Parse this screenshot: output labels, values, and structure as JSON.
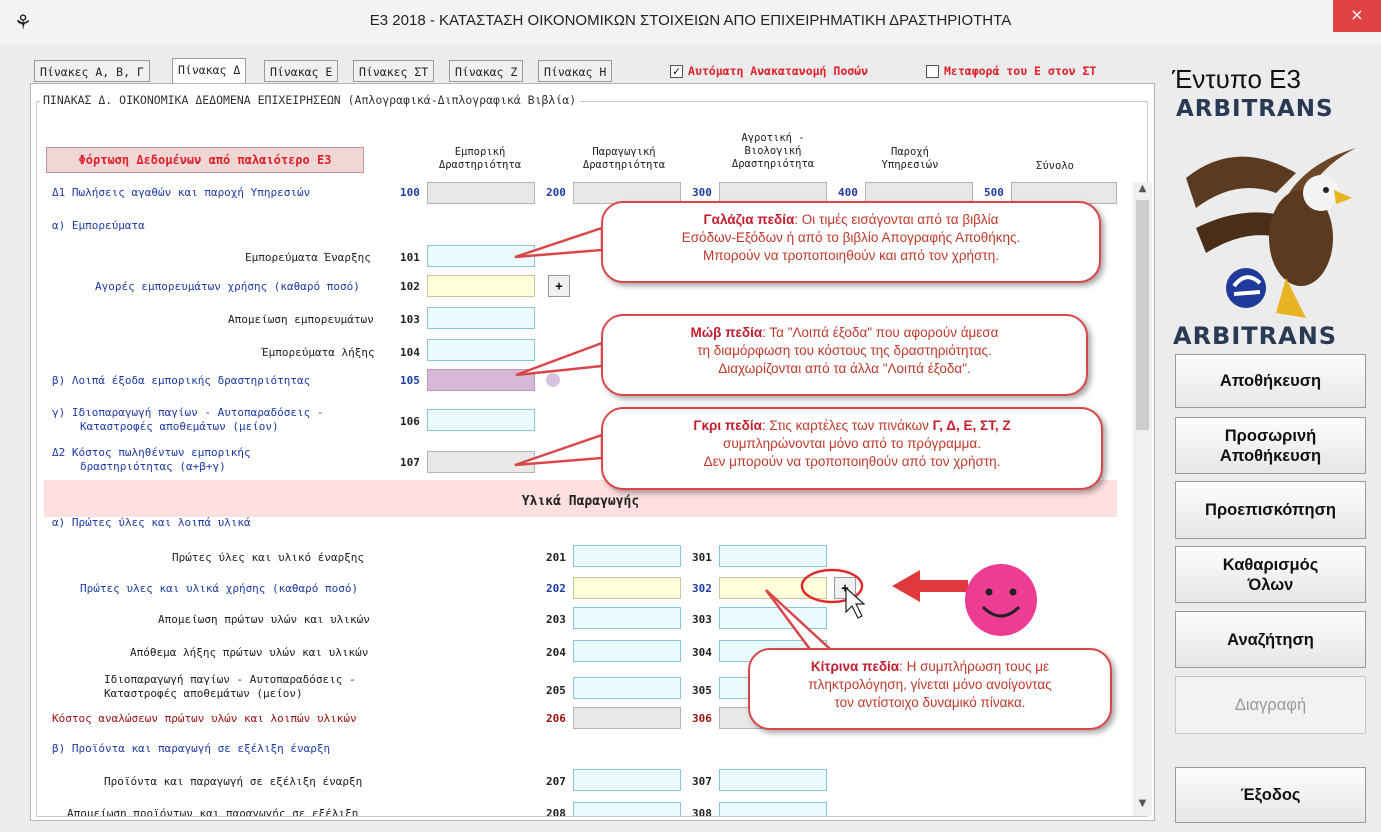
{
  "window": {
    "icon": "⚘",
    "title": "Ε3 2018 - ΚΑΤΑΣΤΑΣΗ ΟΙΚΟΝΟΜΙΚΩΝ ΣΤΟΙΧΕΙΩΝ ΑΠΟ ΕΠΙΧΕΙΡΗΜΑΤΙΚΗ ΔΡΑΣΤΗΡΙΟΤΗΤΑ",
    "close": "×"
  },
  "tabs": [
    "Πίνακες Α, Β, Γ",
    "Πίνακας Δ",
    "Πίνακας Ε",
    "Πίνακες ΣΤ",
    "Πίνακας Ζ",
    "Πίνακας Η"
  ],
  "options": {
    "auto_redistribute": {
      "label": "Αυτόματη Ανακατανομή Ποσών",
      "checked": true,
      "mark": "✓"
    },
    "transfer_e_to_st": {
      "label": "Μεταφορά του Ε στον ΣΤ",
      "checked": false
    }
  },
  "group_title": "ΠΙΝΑΚΑΣ Δ. ΟΙΚΟΝΟΜΙΚΑ ΔΕΔΟΜΕΝΑ ΕΠΙΧΕΙΡΗΣΕΩΝ (Απλογραφικά-Διπλογραφικά Βιβλία)",
  "load_button": "Φόρτωση Δεδομένων από παλαιότερο Ε3",
  "columns": {
    "commercial": [
      "Εμπορική",
      "Δραστηριότητα"
    ],
    "production": [
      "Παραγωγική",
      "Δραστηριότητα"
    ],
    "agricultural": [
      "Αγροτική -",
      "Βιολογική",
      "Δραστηριότητα"
    ],
    "services": [
      "Παροχή",
      "Υπηρεσιών"
    ],
    "total": "Σύνολο"
  },
  "rows": {
    "d1": {
      "label": "Δ1 Πωλήσεις αγαθών και παροχή Υπηρεσιών",
      "codes": [
        "100",
        "200",
        "300",
        "400",
        "500"
      ]
    },
    "a_goods": "α) Εμπορεύματα",
    "r101": {
      "label": "Εμπορεύματα Έναρξης",
      "code": "101"
    },
    "r102": {
      "label": "Αγορές εμπορευμάτων χρήσης (καθαρό ποσό)",
      "code": "102",
      "plus": "+"
    },
    "r103": {
      "label": "Απομείωση εμπορευμάτων",
      "code": "103"
    },
    "r104": {
      "label": "Έμπορεύματα λήξης",
      "code": "104"
    },
    "r105": {
      "label": "β) Λοιπά έξοδα εμπορικής δραστηριότητας",
      "code": "105"
    },
    "r106": {
      "label1": "γ) Ιδιοπαραγωγή παγίων - Αυτοπαραδόσεις -",
      "label2": "Καταστροφές αποθεμάτων (μείον)",
      "code": "106"
    },
    "r107": {
      "label1": "Δ2 Κόστος πωληθέντων εμπορικής",
      "label2": "δραστηριότητας (α+β+γ)",
      "code": "107"
    },
    "section": "Υλικά Παραγωγής",
    "a_raw": "α) Πρώτες ύλες και λοιπά υλικά",
    "r201": {
      "label": "Πρώτες ύλες και υλικό έναρξης",
      "code": "201",
      "code3": "301"
    },
    "r202": {
      "label": "Πρώτες υλες και υλικά χρήσης (καθαρό ποσό)",
      "code": "202",
      "code3": "302",
      "plus": "+"
    },
    "r203": {
      "label": "Απομείωση πρώτων υλών και υλικών",
      "code": "203",
      "code3": "303"
    },
    "r204": {
      "label": "Απόθεμα λήξης πρώτων υλών και υλικών",
      "code": "204",
      "code3": "304"
    },
    "r205": {
      "label1": "Ιδιοπαραγωγή παγίων - Αυτοπαραδόσεις -",
      "label2": "Καταστροφές αποθεμάτων (μείον)",
      "code": "205",
      "code3": "305"
    },
    "r206": {
      "label": "Κόστος αναλώσεων πρώτων υλών και λοιπών υλικών",
      "code": "206",
      "code3": "306"
    },
    "b_products": "β) Προϊόντα και παραγωγή σε εξέλιξη έναρξη",
    "r207": {
      "label": "Προϊόντα και παραγωγή σε εξέλιξη έναρξη",
      "code": "207",
      "code3": "307"
    },
    "r208": {
      "label": "Απομείωση προϊόντων και παραγωγής σε εξέλιξη",
      "code": "208",
      "code3": "308"
    }
  },
  "sidebar": {
    "form_title": "Έντυπο Ε3",
    "brand": "ARBITRANS",
    "buttons": {
      "save": "Αποθήκευση",
      "temp_save_1": "Προσωρινή",
      "temp_save_2": "Αποθήκευση",
      "preview": "Προεπισκόπηση",
      "clear_1": "Καθαρισμός",
      "clear_2": "Όλων",
      "search": "Αναζήτηση",
      "delete": "Διαγραφή",
      "exit": "Έξοδος"
    }
  },
  "callouts": {
    "cyan": {
      "title": "Γαλάζια πεδία",
      "l1": ": Οι τιμές εισάγονται από τα βιβλία",
      "l2": "Εσόδων-Εξόδων ή από το βιβλίο Απογραφής Αποθήκης.",
      "l3": "Μπορούν να τροποποιηθούν και από τον χρήστη."
    },
    "mauve": {
      "title": "Μώβ πεδία",
      "l1": ": Τα \"Λοιπά έξοδα\" που αφορούν άμεσα",
      "l2": "τη διαμόρφωση του κόστους της δραστηριότητας.",
      "l3": "Διαχωρίζονται από τα άλλα \"Λοιπά έξοδα\"."
    },
    "gray": {
      "title": "Γκρι πεδία",
      "l1a": ": Στις καρτέλες των πινάκων ",
      "l1b": "Γ, Δ, Ε, ΣΤ, Ζ",
      "l2": "συμπληρώνονται μόνο από το πρόγραμμα.",
      "l3": "Δεν μπορούν να τροποποιηθούν από τον χρήστη."
    },
    "yellow": {
      "title": "Κίτρινα πεδία",
      "l1": ": Η συμπλήρωση τους με",
      "l2": "πληκτρολόγηση, γίνεται μόνο ανοίγοντας",
      "l3": "τον αντίστοιχο δυναμικό πίνακα."
    }
  },
  "colors": {
    "accent_red": "#e0202a",
    "field_cyan": "#e9fbff",
    "field_yellow": "#ffffd9",
    "field_gray": "#e8e8e8",
    "field_mauve": "#d8b8d8",
    "callout_border": "#d9474a"
  }
}
